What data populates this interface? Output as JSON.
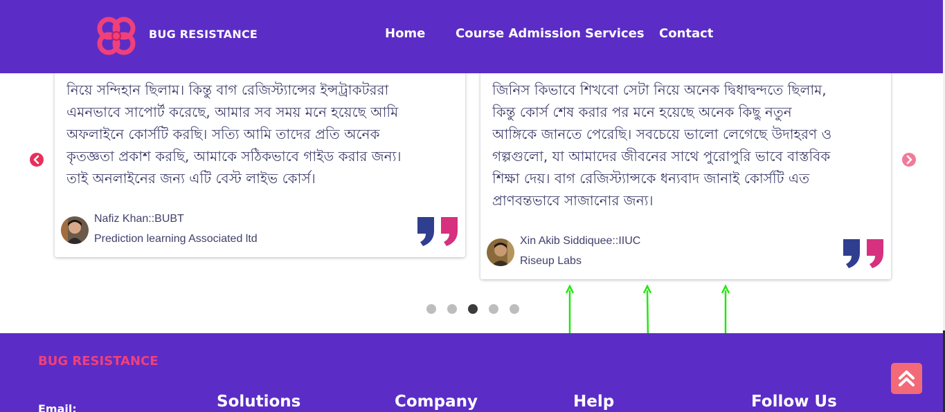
{
  "header": {
    "brand": "BUG RESISTANCE",
    "nav": [
      "Home",
      "Course Admission",
      "Services",
      "Contact"
    ]
  },
  "testimonials": [
    {
      "lines": [
        "নিয়ে সন্দিহান ছিলাম। কিন্তু বাগ রেজিস্ট্যান্সের ইন্সট্রাকটররা",
        "এমনভাবে সাপোর্ট করেছে, আমার সব সময় মনে হয়েছে আমি",
        "অফলাইনে কোর্সটি করছি। সত্যি আমি তাদের প্রতি অনেক",
        "কৃতজ্ঞতা প্রকাশ করছি, আমাকে সঠিকভাবে গাইড করার জন্য।",
        "তাই অনলাইনের জন্য এটি বেস্ট লাইভ কোর্স।"
      ],
      "name": "Nafiz Khan::BUBT",
      "org": "Prediction learning Associated ltd"
    },
    {
      "lines": [
        "জিনিস কিভাবে শিখবো সেটা নিয়ে অনেক দ্বিধাদ্বন্দতে ছিলাম,",
        "কিন্তু কোর্স শেষ করার পর মনে হয়েছে অনেক কিছু নতুন",
        "আঙ্গিকে জানতে পেরেছি। সবচেয়ে ভালো লেগেছে উদাহরণ ও",
        "গল্পগুলো, যা আমাদের জীবনের সাথে পুরোপুরি ভাবে বাস্তবিক",
        "শিক্ষা দেয়। বাগ রেজিস্ট্যান্সকে ধন্যবাদ জানাই কোর্সটি এত",
        "প্রাণবন্তভাবে সাজানোর জন্য।"
      ],
      "name": "Xin Akib Siddiquee::IIUC",
      "org": "Riseup Labs"
    }
  ],
  "carousel": {
    "dot_count": 5,
    "active_index": 2
  },
  "footer": {
    "brand": "BUG RESISTANCE",
    "email_label": "Email:",
    "columns": [
      "Solutions",
      "Company",
      "Help",
      "Follow Us"
    ]
  },
  "colors": {
    "primary": "#5b2dc6",
    "accent_pink": "#e8305a",
    "quote_blue": "#2f3e8f",
    "quote_pink": "#d6307f",
    "annotation_green": "#22e60f"
  },
  "icons": [
    "logo-icon",
    "chevron-left-icon",
    "chevron-right-icon",
    "quote-icon",
    "double-chevron-up-icon"
  ]
}
